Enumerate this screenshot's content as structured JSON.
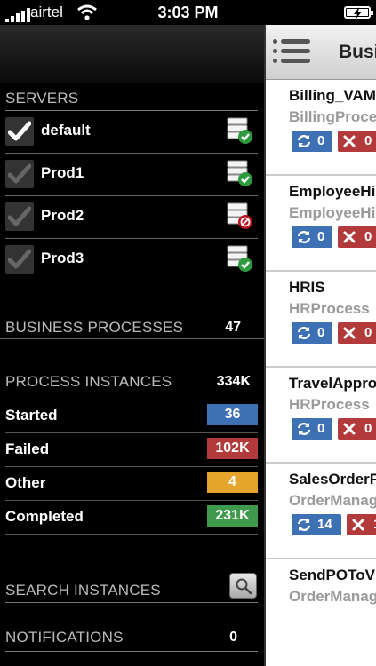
{
  "status_bar": {
    "carrier": "airtel",
    "time": "3:03 PM"
  },
  "menu": {
    "servers_heading": "SERVERS",
    "servers": [
      {
        "name": "default",
        "checked": true,
        "status": "online"
      },
      {
        "name": "Prod1",
        "checked": false,
        "status": "online"
      },
      {
        "name": "Prod2",
        "checked": false,
        "status": "offline"
      },
      {
        "name": "Prod3",
        "checked": false,
        "status": "online"
      }
    ],
    "business_processes_label": "BUSINESS PROCESSES",
    "business_processes_count": "47",
    "process_instances_label": "PROCESS INSTANCES",
    "process_instances_count": "334K",
    "stats": [
      {
        "label": "Started",
        "value": "36",
        "color": "#3e70b4"
      },
      {
        "label": "Failed",
        "value": "102K",
        "color": "#b23a3a"
      },
      {
        "label": "Other",
        "value": "4",
        "color": "#e5a42c"
      },
      {
        "label": "Completed",
        "value": "231K",
        "color": "#3f9a4c"
      }
    ],
    "search_label": "SEARCH INSTANCES",
    "notifications_label": "NOTIFICATIONS",
    "notifications_count": "0"
  },
  "panel": {
    "title": "Busi",
    "processes": [
      {
        "name": "Billing_VAM",
        "type": "BillingProce",
        "running": "0",
        "failed": "0"
      },
      {
        "name": "EmployeeHi",
        "type": "EmployeeHi",
        "running": "0",
        "failed": "0"
      },
      {
        "name": "HRIS",
        "type": "HRProcess",
        "running": "0",
        "failed": "0"
      },
      {
        "name": "TravelAppro",
        "type": "HRProcess",
        "running": "0",
        "failed": "0"
      },
      {
        "name": "SalesOrderF",
        "type": "OrderManag",
        "running": "14",
        "failed": "1"
      },
      {
        "name": "SendPOToV",
        "type": "OrderManag",
        "running": "",
        "failed": ""
      }
    ]
  }
}
